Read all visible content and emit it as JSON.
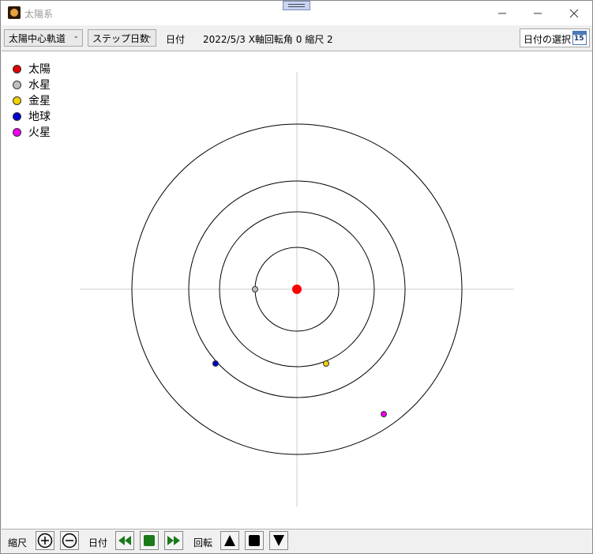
{
  "window": {
    "title": "太陽系"
  },
  "toolbar": {
    "view_mode": "太陽中心軌道",
    "step_unit": "ステップ日数",
    "date_label": "日付",
    "status_text": "2022/5/3 X軸回転角 0  縮尺 2",
    "select_date_button": "日付の選択",
    "calendar_day": "15"
  },
  "legend": [
    {
      "label": "太陽",
      "color": "#e00000"
    },
    {
      "label": "水星",
      "color": "#c0c0c0"
    },
    {
      "label": "金星",
      "color": "#f0d000"
    },
    {
      "label": "地球",
      "color": "#0000cc"
    },
    {
      "label": "火星",
      "color": "#ee00ee"
    }
  ],
  "bottom": {
    "scale_label": "縮尺",
    "date_label": "日付",
    "rotate_label": "回転"
  },
  "colors": {
    "play_green": "#1a7a1a",
    "orbit_line": "#000000",
    "axis_line": "#cccccc"
  }
}
